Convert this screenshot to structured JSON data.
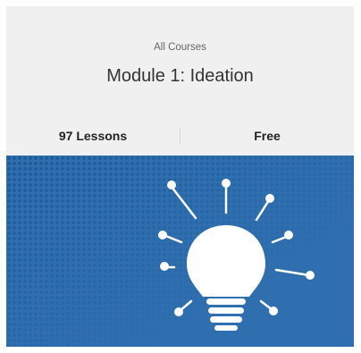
{
  "course": {
    "breadcrumb": "All Courses",
    "title": "Module 1: Ideation",
    "lessons": "97 Lessons",
    "price": "Free"
  },
  "hero": {
    "icon": "lightbulb-icon",
    "background_color": "#2f6eaf",
    "icon_color": "#ffffff"
  }
}
